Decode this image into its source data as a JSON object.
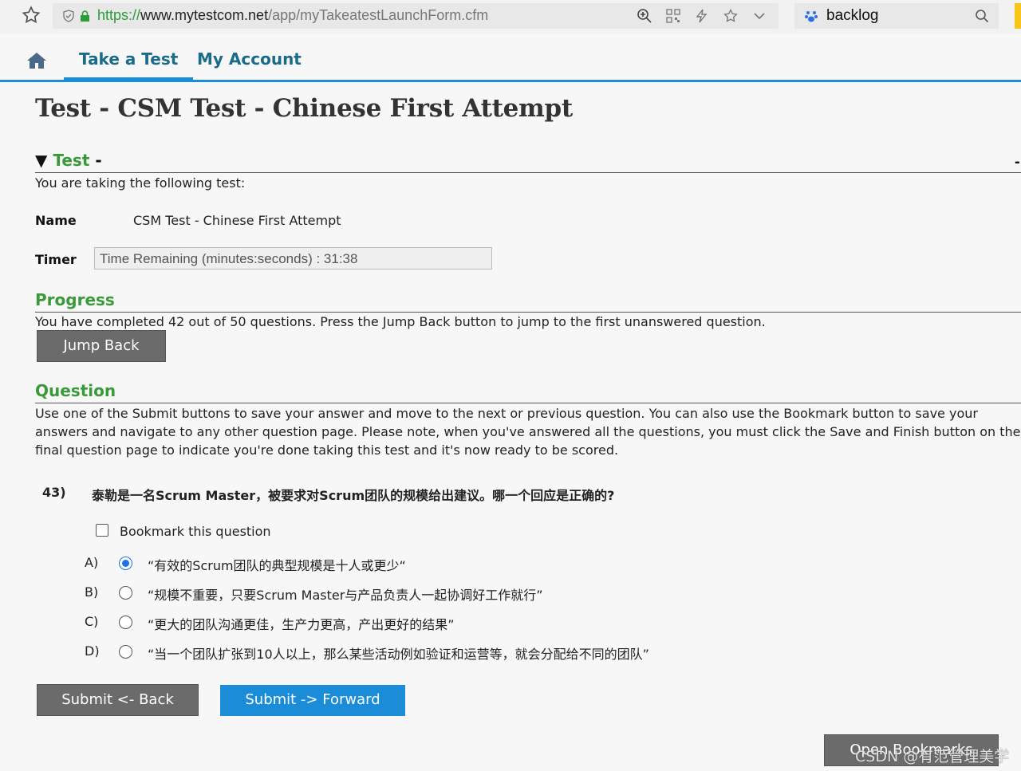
{
  "browser": {
    "url_scheme": "https://",
    "url_host": "www.mytestcom.net",
    "url_path": "/app/myTakeatestLaunchForm.cfm",
    "search_query": "backlog"
  },
  "nav": {
    "take_test": "Take a Test",
    "my_account": "My Account"
  },
  "page": {
    "title": "Test - CSM Test - Chinese First Attempt"
  },
  "test_section": {
    "heading": "Test",
    "heading_suffix": "-",
    "intro": "You are taking the following test:",
    "name_label": "Name",
    "name_value": "CSM Test - Chinese First Attempt",
    "timer_label": "Timer",
    "timer_value": "Time Remaining (minutes:seconds) : 31:38"
  },
  "progress": {
    "heading": "Progress",
    "text": "You have completed 42 out of 50 questions. Press the Jump Back button to jump to the first unanswered question.",
    "jump_back_label": "Jump Back"
  },
  "question": {
    "heading": "Question",
    "instructions": "Use one of the Submit buttons to save your answer and move to the next or previous question. You can also use the Bookmark button to save your answers and navigate to any other question page. Please note, when you've answered all the questions, you must click the Save and Finish button on the final question page to indicate you're done taking this test and it's now ready to be scored.",
    "number": "43)",
    "text": "泰勒是一名Scrum Master，被要求对Scrum团队的规模给出建议。哪一个回应是正确的?",
    "bookmark_label": "Bookmark this question",
    "options": [
      {
        "letter": "A)",
        "text": "“有效的Scrum团队的典型规模是十人或更少“",
        "selected": true
      },
      {
        "letter": "B)",
        "text": "“规模不重要，只要Scrum Master与产品负责人一起协调好工作就行”",
        "selected": false
      },
      {
        "letter": "C)",
        "text": "“更大的团队沟通更佳，生产力更高，产出更好的结果”",
        "selected": false
      },
      {
        "letter": "D)",
        "text": "“当一个团队扩张到10人以上，那么某些活动例如验证和运营等，就会分配给不同的团队”",
        "selected": false
      }
    ],
    "submit_back_label": "Submit <- Back",
    "submit_forward_label": "Submit -> Forward"
  },
  "footer": {
    "open_bookmarks_label": "Open Bookmarks",
    "watermark": "CSDN @有范管理美学"
  },
  "colors": {
    "accent_blue": "#1a8cd8",
    "section_green": "#3a9a3a",
    "button_gray": "#6b6b6b"
  }
}
